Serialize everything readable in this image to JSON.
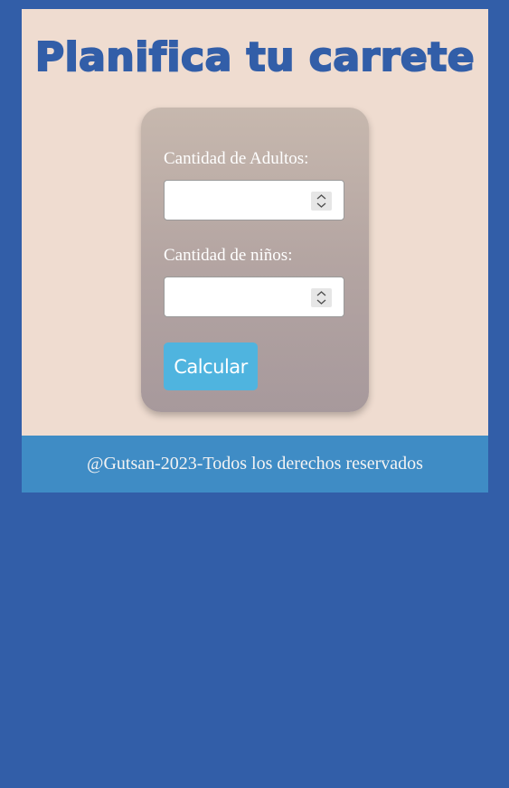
{
  "title": "Planifica tu carrete",
  "form": {
    "adults_label": "Cantidad de Adultos:",
    "adults_value": "",
    "kids_label": "Cantidad de niños:",
    "kids_value": "",
    "submit_label": "Calcular"
  },
  "footer": {
    "text": "@Gutsan-2023-Todos los derechos reservados"
  },
  "colors": {
    "page_background": "#325ea8",
    "main_background": "#efdcd0",
    "title": "#325ea8",
    "button": "#4fb4df",
    "footer": "#3f8cc5"
  }
}
